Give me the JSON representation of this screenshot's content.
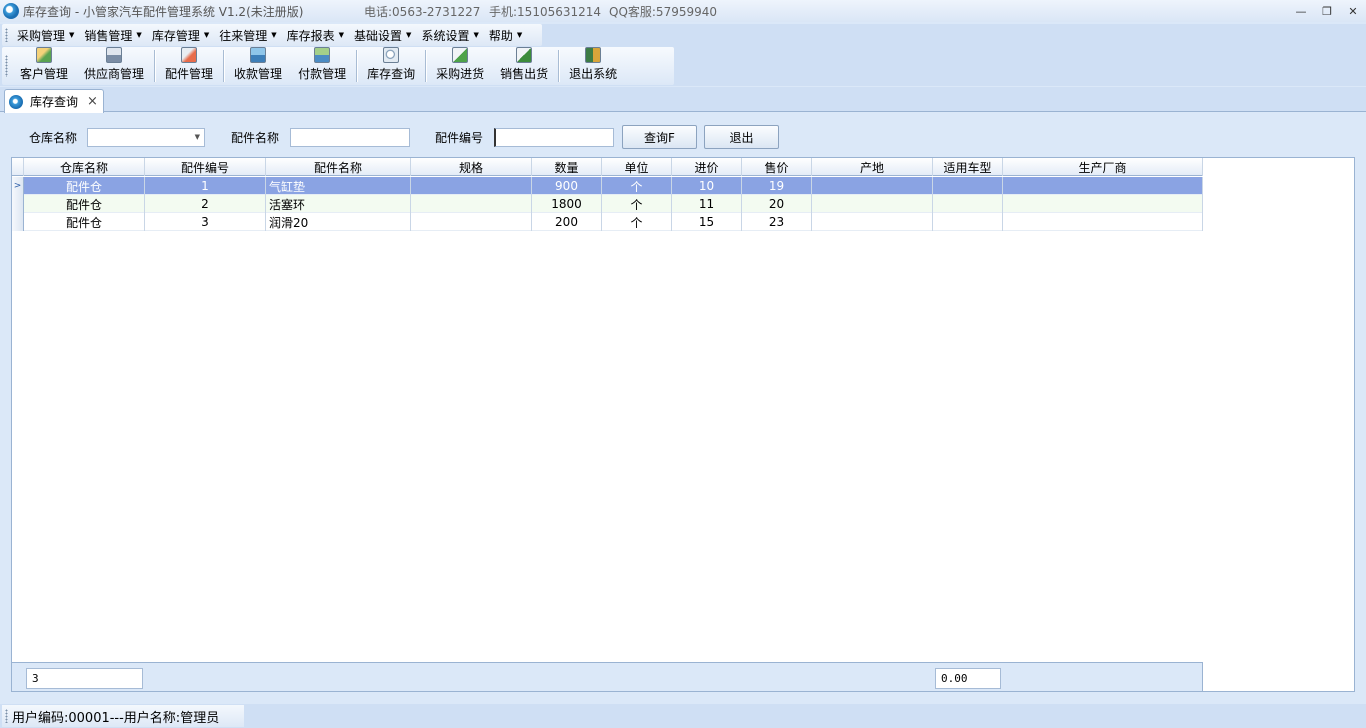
{
  "window": {
    "title": "库存查询 - 小管家汽车配件管理系统 V1.2(未注册版)",
    "phone": "电话:0563-2731227",
    "mobile": "手机:15105631214",
    "qq": "QQ客服:57959940",
    "controls": [
      "minimize-icon",
      "restore-icon",
      "close-icon"
    ]
  },
  "menu": [
    {
      "label": "采购管理"
    },
    {
      "label": "销售管理"
    },
    {
      "label": "库存管理"
    },
    {
      "label": "往来管理"
    },
    {
      "label": "库存报表"
    },
    {
      "label": "基础设置"
    },
    {
      "label": "系统设置"
    },
    {
      "label": "帮助"
    }
  ],
  "toolbar": [
    {
      "label": "客户管理",
      "icon": "customer-icon"
    },
    {
      "label": "供应商管理",
      "icon": "supplier-icon"
    },
    {
      "label": "配件管理",
      "icon": "parts-icon"
    },
    {
      "label": "收款管理",
      "icon": "receipt-icon"
    },
    {
      "label": "付款管理",
      "icon": "payment-icon"
    },
    {
      "label": "库存查询",
      "icon": "stock-query-icon"
    },
    {
      "label": "采购进货",
      "icon": "purchase-icon"
    },
    {
      "label": "销售出货",
      "icon": "sales-icon"
    },
    {
      "label": "退出系统",
      "icon": "exit-icon"
    }
  ],
  "tab": {
    "label": "库存查询",
    "close": "×"
  },
  "filters": {
    "warehouse_label": "仓库名称",
    "warehouse_value": "",
    "part_name_label": "配件名称",
    "part_name_value": "",
    "part_no_label": "配件编号",
    "part_no_value": "",
    "query_button": "查询F",
    "exit_button": "退出"
  },
  "grid": {
    "columns": [
      "仓库名称",
      "配件编号",
      "配件名称",
      "规格",
      "数量",
      "单位",
      "进价",
      "售价",
      "产地",
      "适用车型",
      "生产厂商"
    ],
    "rows": [
      [
        "配件仓",
        "1",
        "气缸垫",
        "",
        "900",
        "个",
        "10",
        "19",
        "",
        "",
        ""
      ],
      [
        "配件仓",
        "2",
        "活塞环",
        "",
        "1800",
        "个",
        "11",
        "20",
        "",
        "",
        ""
      ],
      [
        "配件仓",
        "3",
        "润滑20",
        "",
        "200",
        "个",
        "15",
        "23",
        "",
        "",
        ""
      ]
    ],
    "selected_row_indicator": ">",
    "footer_count": "3",
    "footer_total": "0.00"
  },
  "status": {
    "text": "用户编码:00001---用户名称:管理员"
  },
  "colors": {
    "selected_row": "#8aa3e3",
    "alt_row": "#f3fbf1",
    "background": "#dbe8f8"
  }
}
